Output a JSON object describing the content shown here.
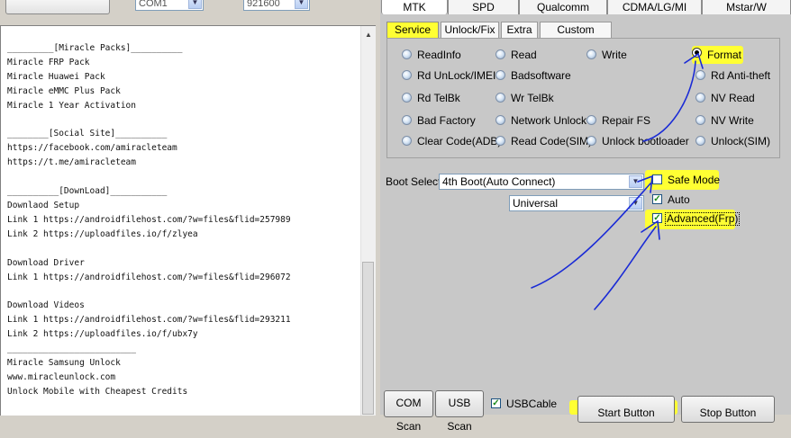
{
  "top": {
    "port_value": "COM1",
    "baud_value": "921600"
  },
  "log": {
    "lines": [
      "_________[Miracle Packs]__________",
      "Miracle FRP Pack",
      "Miracle Huawei Pack",
      "Miracle eMMC Plus Pack",
      "Miracle 1 Year Activation",
      "",
      "________[Social Site]__________",
      "https://facebook.com/amiracleteam",
      "https://t.me/amiracleteam",
      "",
      "__________[DownLoad]___________",
      "Downlaod Setup",
      "Link 1 https://androidfilehost.com/?w=files&flid=257989",
      "Link 2 https://uploadfiles.io/f/zlyea",
      "",
      "Download Driver",
      "Link 1 https://androidfilehost.com/?w=files&flid=296072",
      "",
      "Download Videos",
      "Link 1 https://androidfilehost.com/?w=files&flid=293211",
      "Link 2 https://uploadfiles.io/f/ubx7y",
      "_________________________",
      "Miracle Samsung Unlock",
      "www.miracleunlock.com",
      "Unlock Mobile with Cheapest Credits"
    ]
  },
  "main_tabs": [
    "MTK",
    "SPD",
    "Qualcomm",
    "CDMA/LG/MI",
    "Mstar/W"
  ],
  "sub_tabs": [
    "Service",
    "Unlock/Fix",
    "Extra",
    "Custom Setting"
  ],
  "options": {
    "col1": [
      "ReadInfo",
      "Rd UnLock/IMEI",
      "Rd TelBk",
      "Bad Factory",
      "Clear Code(ADB)"
    ],
    "col2": [
      "Read",
      "Badsoftware",
      "Wr TelBk",
      "Network Unlock",
      "Read Code(SIM)"
    ],
    "col3": [
      "Write",
      "Repair FS",
      "Unlock bootloader"
    ],
    "col4": [
      "Format",
      "Rd Anti-theft",
      "NV Read",
      "NV Write",
      "Unlock(SIM)"
    ]
  },
  "boot": {
    "label": "Boot Select:",
    "value": "4th Boot(Auto Connect)",
    "second_value": "Universal"
  },
  "checks": {
    "safe_mode": "Safe Mode",
    "auto": "Auto",
    "advanced": "Advanced(Frp)"
  },
  "bottom": {
    "com_scan": "COM Scan",
    "usb_scan": "USB Scan",
    "usb_cable": "USBCable",
    "start": "Start Button",
    "stop": "Stop Button"
  },
  "colors": {
    "highlight": "#ffff33",
    "annotation_pen": "#1a2bd6"
  }
}
